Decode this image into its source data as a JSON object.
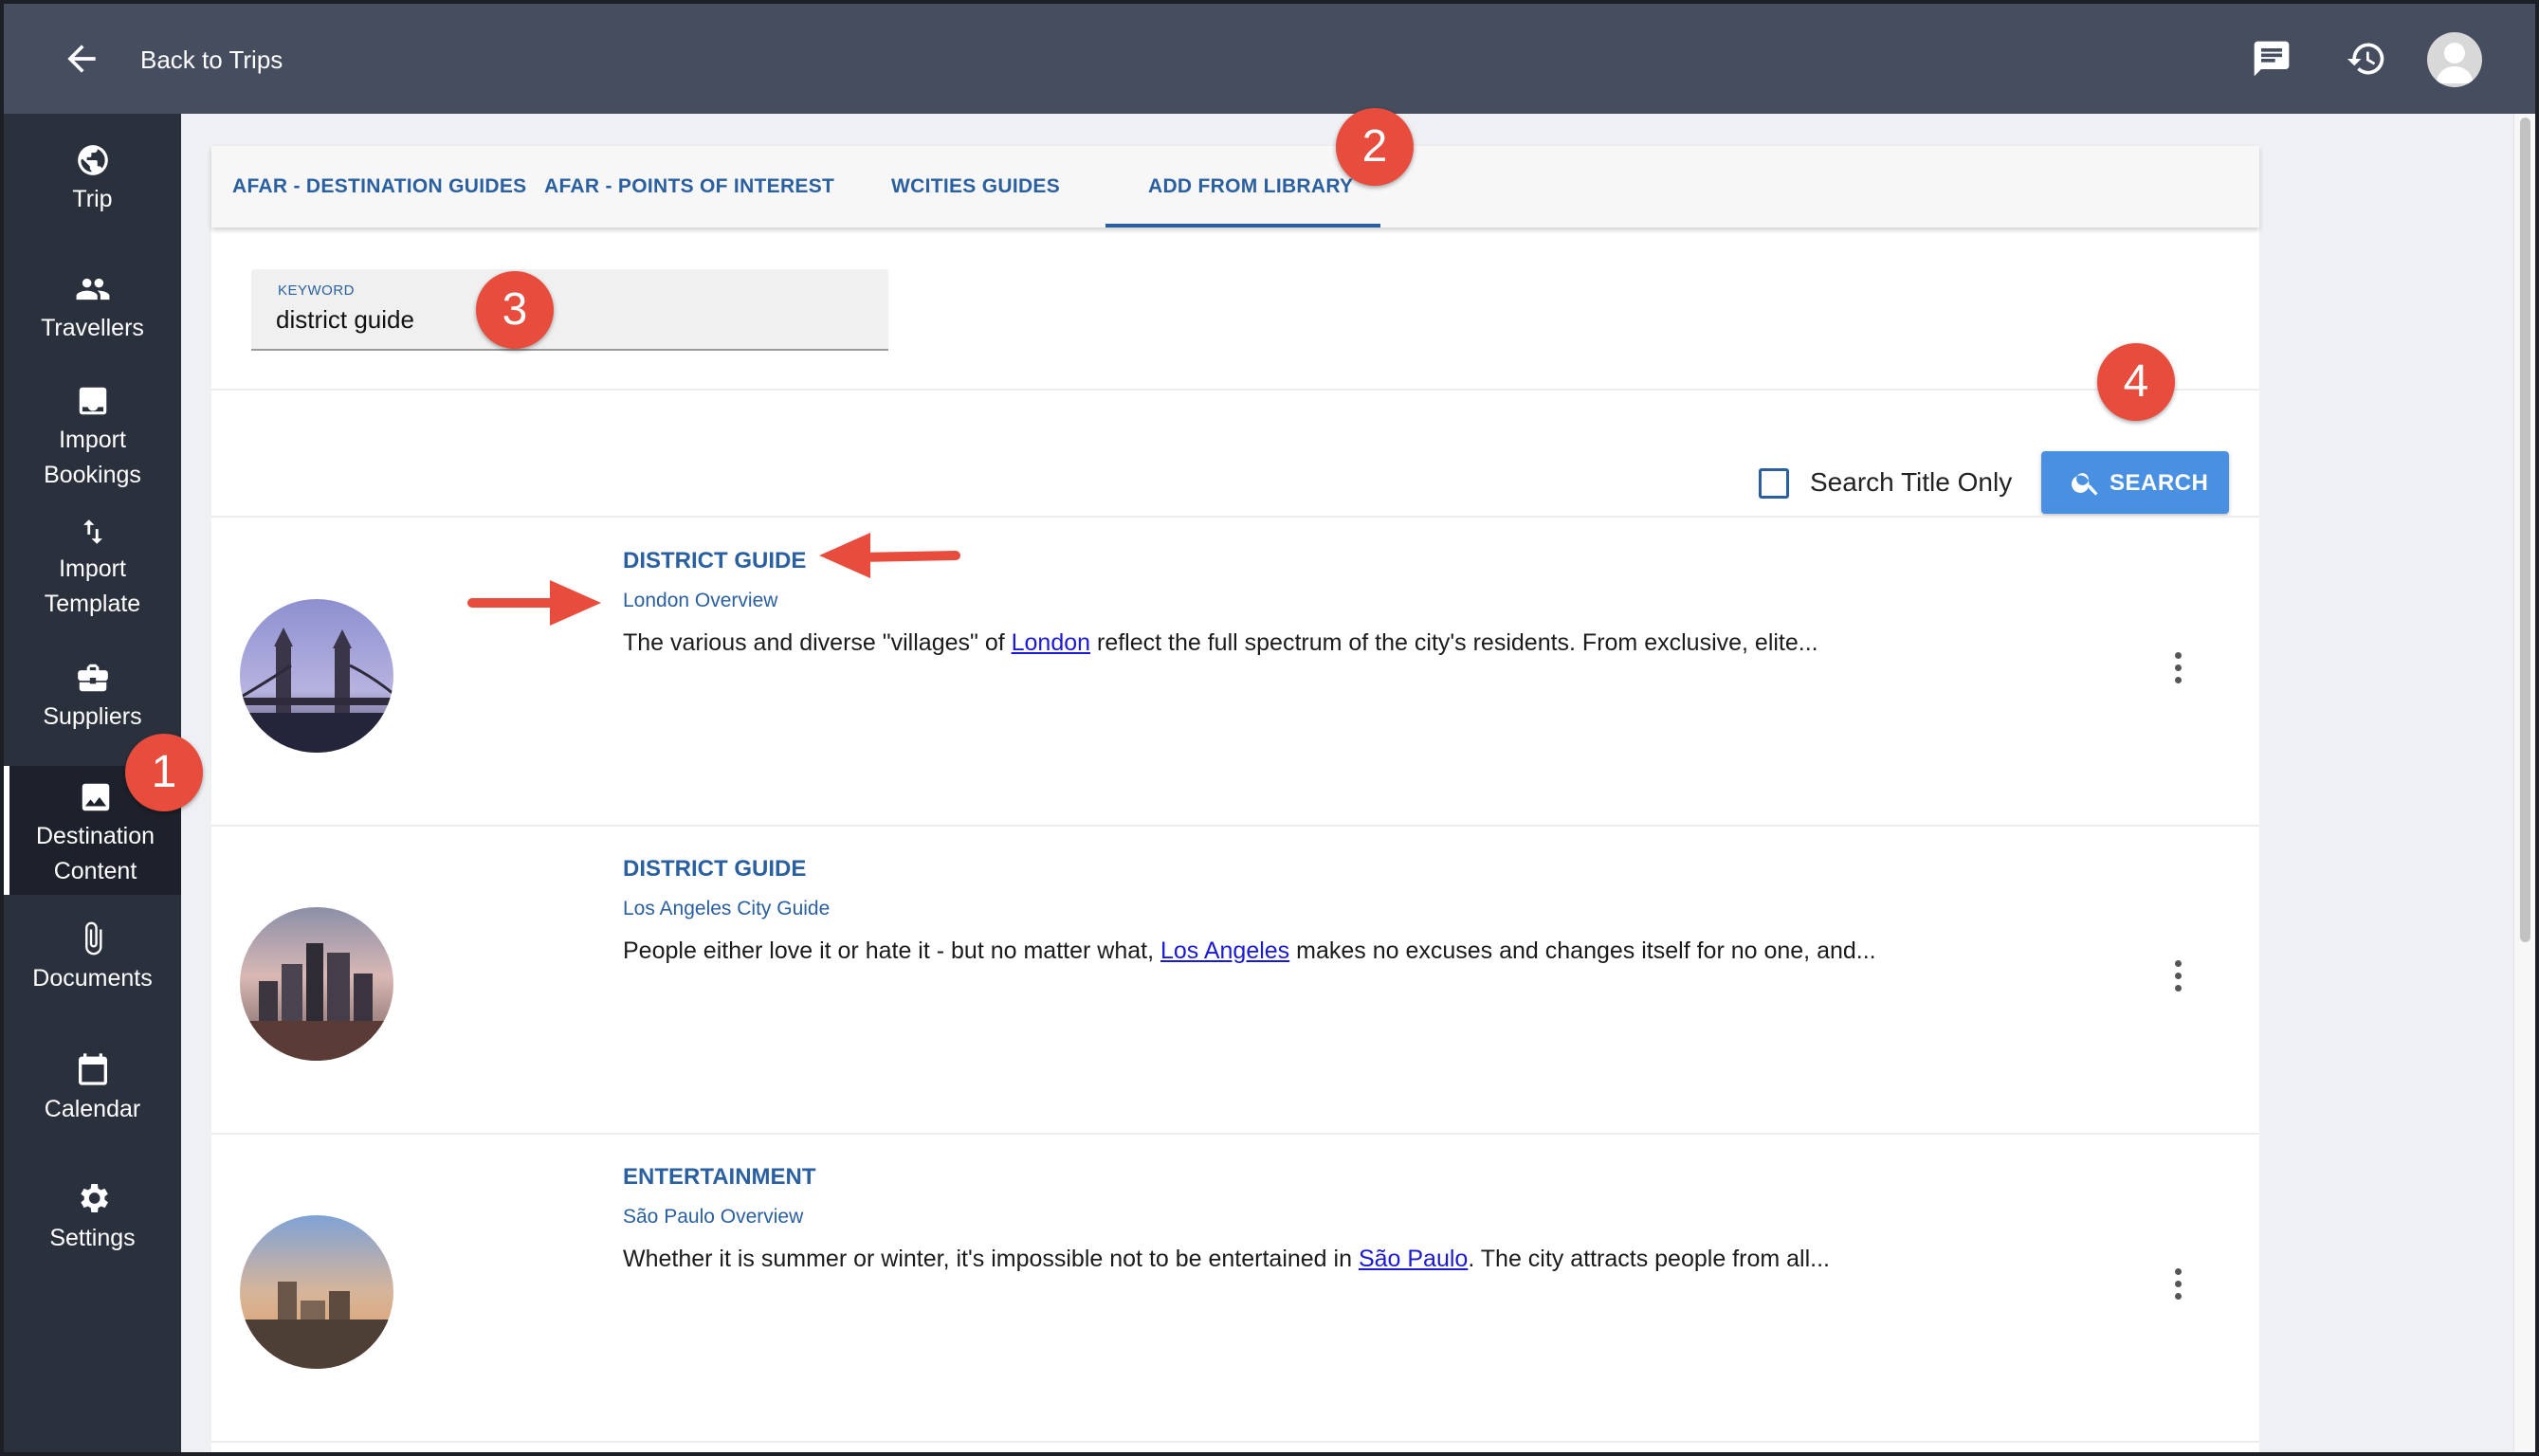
{
  "topbar": {
    "back_label": "Back to Trips",
    "icons": [
      "arrow-left-icon",
      "chat-icon",
      "history-icon",
      "avatar"
    ]
  },
  "sidebar": {
    "items": [
      {
        "label": "Trip",
        "icon": "globe-icon"
      },
      {
        "label": "Travellers",
        "icon": "people-icon"
      },
      {
        "label": "Import Bookings",
        "line1": "Import",
        "line2": "Bookings",
        "icon": "import-icon"
      },
      {
        "label": "Import Template",
        "line1": "Import",
        "line2": "Template",
        "icon": "swap-vertical-icon"
      },
      {
        "label": "Suppliers",
        "icon": "briefcase-icon"
      },
      {
        "label": "Destination Content",
        "line1": "Destination",
        "line2": "Content",
        "icon": "image-icon",
        "active": true
      },
      {
        "label": "Documents",
        "icon": "paperclip-icon"
      },
      {
        "label": "Calendar",
        "icon": "calendar-icon"
      },
      {
        "label": "Settings",
        "icon": "gear-icon"
      }
    ]
  },
  "tabs": [
    {
      "label": "AFAR - DESTINATION GUIDES"
    },
    {
      "label": "AFAR - POINTS OF INTEREST"
    },
    {
      "label": "WCITIES GUIDES"
    },
    {
      "label": "ADD FROM LIBRARY",
      "active": true
    }
  ],
  "search": {
    "keyword_label": "KEYWORD",
    "keyword_value": "district guide",
    "title_only_label": "Search Title Only",
    "title_only_checked": false,
    "button_label": "SEARCH"
  },
  "results": [
    {
      "title": "DISTRICT GUIDE",
      "subtitle": "London Overview",
      "desc_before": "The various and diverse \"villages\" of ",
      "link": "London",
      "desc_after": " reflect the full spectrum of the city's residents. From exclusive, elite..."
    },
    {
      "title": "DISTRICT GUIDE",
      "subtitle": "Los Angeles City Guide",
      "desc_before": "People either love it or hate it - but no matter what, ",
      "link": "Los Angeles",
      "desc_after": " makes no excuses and changes itself for no one, and..."
    },
    {
      "title": "ENTERTAINMENT",
      "subtitle": "São Paulo Overview",
      "desc_before": "Whether it is summer or winter, it's impossible not to be entertained in ",
      "link": "São Paulo",
      "desc_after": ". The city attracts people from all..."
    }
  ],
  "callouts": [
    "1",
    "2",
    "3",
    "4"
  ],
  "colors": {
    "accent": "#2a5fa0",
    "button": "#4a90e2",
    "callout": "#e74c3c",
    "sidebar": "#2b303d",
    "topbar": "#454d5f"
  }
}
